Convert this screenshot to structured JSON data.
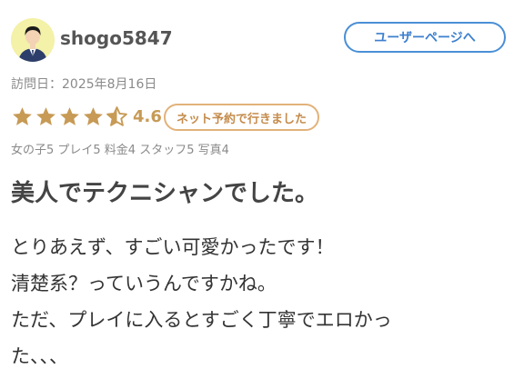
{
  "user": {
    "name": "shogo5847",
    "profile_button": "ユーザーページへ"
  },
  "visit": {
    "text": "訪問日：2025年8月16日"
  },
  "rating": {
    "stars_filled": 4.5,
    "stars_max": 5,
    "score": "4.6",
    "badge": "ネット予約で行きました"
  },
  "sub_scores": {
    "text": "女の子5 プレイ5 料金4 スタッフ5 写真4"
  },
  "review": {
    "title": "美人でテクニシャンでした。",
    "lines": [
      "とりあえず、すごい可愛かったです！",
      "清楚系？っていうんですかね。",
      "ただ、プレイに入るとすごく丁寧でエロかっ",
      "た、、、"
    ]
  },
  "colors": {
    "star": "#c79a55",
    "accent_blue": "#4a8fd6",
    "badge_border": "#e2b27a"
  }
}
